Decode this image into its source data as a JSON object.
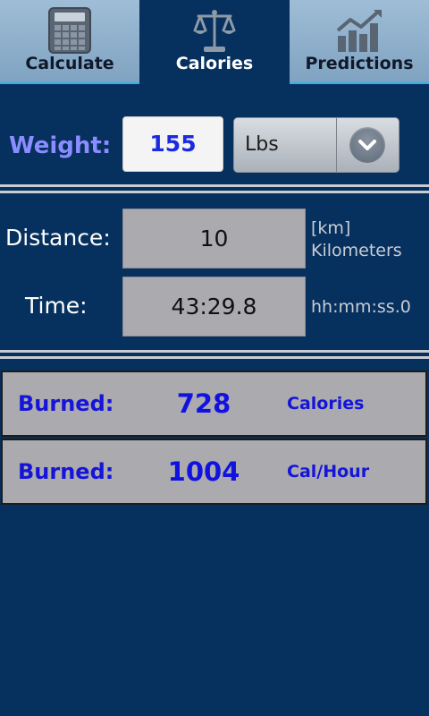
{
  "tabs": [
    {
      "label": "Calculate",
      "icon": "calculator-icon",
      "active": false
    },
    {
      "label": "Calories",
      "icon": "scale-icon",
      "active": true
    },
    {
      "label": "Predictions",
      "icon": "bar-chart-icon",
      "active": false
    }
  ],
  "weight": {
    "label": "Weight:",
    "value": "155",
    "unit": "Lbs"
  },
  "distance": {
    "label": "Distance:",
    "value": "10",
    "hint_line1": "[km]",
    "hint_line2": "Kilometers"
  },
  "time": {
    "label": "Time:",
    "value": "43:29.8",
    "hint": "hh:mm:ss.0"
  },
  "results": [
    {
      "label": "Burned:",
      "value": "728",
      "unit": "Calories"
    },
    {
      "label": "Burned:",
      "value": "1004",
      "unit": "Cal/Hour"
    }
  ],
  "colors": {
    "background": "#06305e",
    "tab_inactive": "#8fb0cc",
    "accent_line": "#2fb3e6",
    "weight_label": "#8a8cff",
    "result_text": "#1515d8",
    "field_gray": "#abaaaf"
  }
}
